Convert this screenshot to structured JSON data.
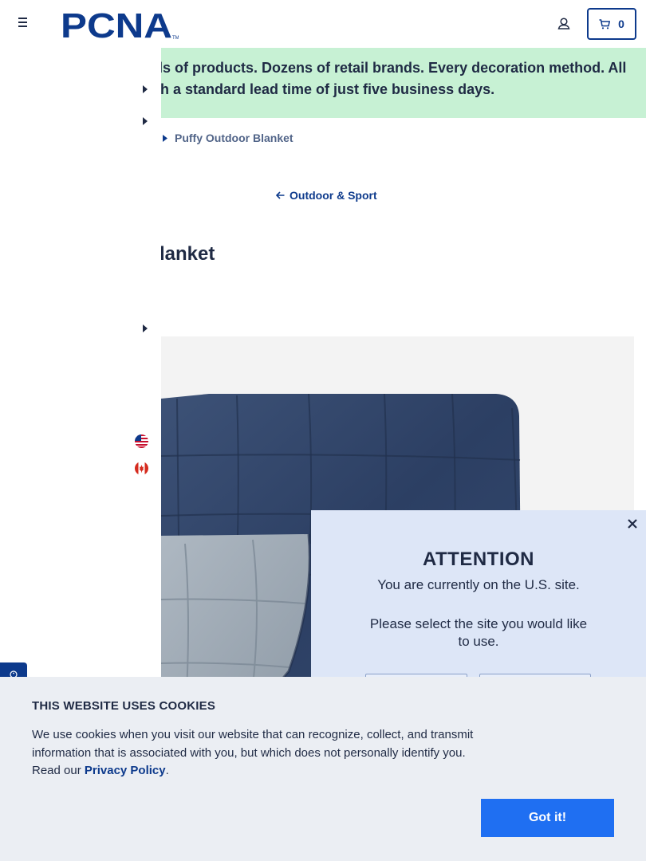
{
  "header": {
    "logo_text": "PCNA",
    "logo_tm": "TM",
    "cart_count": "0"
  },
  "promo": {
    "line1": "ls of products. Dozens of retail brands. Every decoration method. All",
    "line2": "th a standard lead time of just five business days."
  },
  "breadcrumb": {
    "current": "Puffy Outdoor Blanket"
  },
  "back_link": {
    "label": "Outdoor & Sport"
  },
  "product": {
    "title_visible": "lanket"
  },
  "attention": {
    "title": "ATTENTION",
    "message": "You are currently on the U.S. site.",
    "prompt": "Please select the site you would like to use."
  },
  "cookie": {
    "title": "THIS WEBSITE USES COOKIES",
    "text_before": "We use cookies when you visit our website that can recognize, collect, and transmit information that is associated with you, but which does not personally identify you. Read our ",
    "link": "Privacy Policy",
    "text_after": ".",
    "button": "Got it!"
  },
  "colors": {
    "navy": "#1f2a44",
    "brand_blue": "#0d3a8c",
    "promo_green": "#c7f1d4",
    "popup_blue": "#dde6f7",
    "cookie_bg": "#ebeef3",
    "button_blue": "#1f6ff2"
  },
  "icons": {
    "menu": "hamburger-icon",
    "account": "user-icon",
    "cart": "cart-icon",
    "close": "close-icon",
    "back": "arrow-left-icon",
    "caret": "caret-right-icon",
    "flag_us": "us-flag-icon",
    "flag_ca": "canada-flag-icon",
    "accessibility": "accessibility-icon"
  }
}
